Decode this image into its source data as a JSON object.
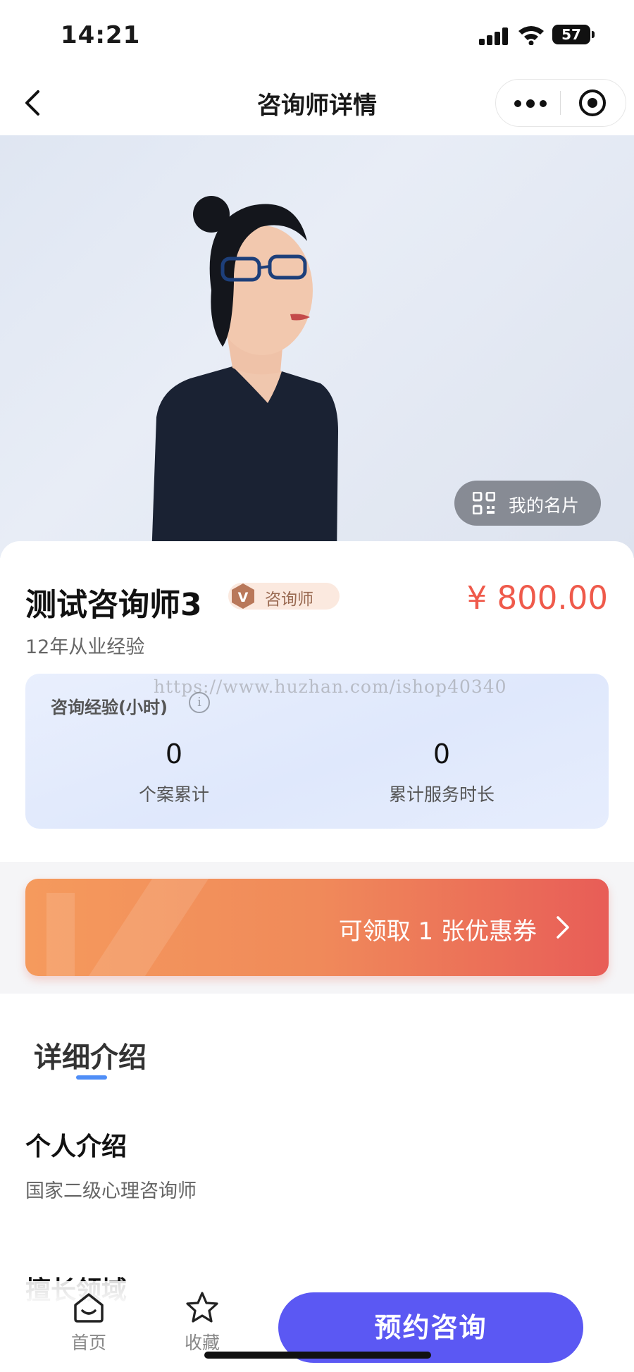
{
  "status_bar": {
    "time": "14:21",
    "battery": "57"
  },
  "nav": {
    "title": "咨询师详情"
  },
  "hero": {
    "namecard_label": "我的名片"
  },
  "profile": {
    "name": "测试咨询师3",
    "badge": "咨询师",
    "badge_icon_letter": "V",
    "price": "¥ 800.00",
    "experience": "12年从业经验"
  },
  "stats": {
    "title": "咨询经验(小时)",
    "info_glyph": "i",
    "items": [
      {
        "value": "0",
        "label": "个案累计"
      },
      {
        "value": "0",
        "label": "累计服务时长"
      }
    ],
    "watermark": "https://www.huzhan.com/ishop40340"
  },
  "coupon": {
    "text": "可领取 1 张优惠券"
  },
  "details": {
    "tab": "详细介绍",
    "intro_title": "个人介绍",
    "intro_text": "国家二级心理咨询师",
    "expertise_title": "擅长领域"
  },
  "bottom_bar": {
    "home_label": "首页",
    "fav_label": "收藏",
    "book_label": "预约咨询"
  },
  "colors": {
    "price": "#ef5a4b",
    "primary_button": "#5b58f3",
    "tab_underline": "#4f8ef7",
    "coupon_start": "#f59a5d",
    "coupon_end": "#e85d57"
  }
}
